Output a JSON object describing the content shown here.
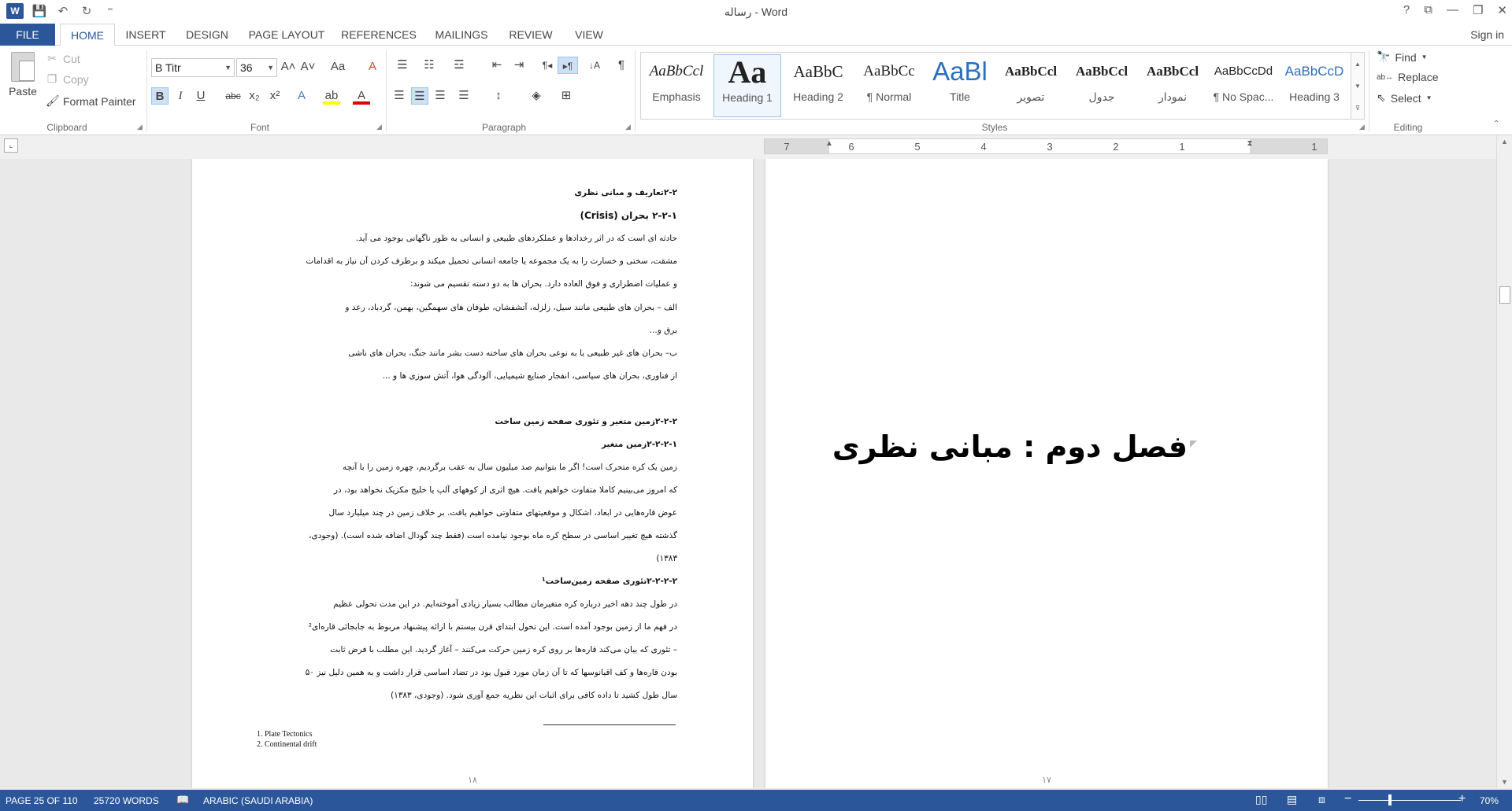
{
  "title": {
    "text": "رساله - Word",
    "help": "?",
    "ribbon_display": "⧉",
    "minimize": "—",
    "restore": "❐",
    "close": "✕"
  },
  "qat": {
    "logo": "W",
    "save": "💾",
    "undo": "↶",
    "redo": "↻",
    "customize": "⁼"
  },
  "tabs": [
    "FILE",
    "HOME",
    "INSERT",
    "DESIGN",
    "PAGE LAYOUT",
    "REFERENCES",
    "MAILINGS",
    "REVIEW",
    "VIEW"
  ],
  "active_tab": "HOME",
  "sign_in": "Sign in",
  "clipboard": {
    "paste": "Paste",
    "cut": "Cut",
    "copy": "Copy",
    "format_painter": "Format Painter",
    "label": "Clipboard"
  },
  "font": {
    "name": "B Titr",
    "size": "36",
    "label": "Font",
    "buttons": {
      "grow": "A˄",
      "shrink": "A˅",
      "case": "Aa",
      "clear": "A",
      "bold": "B",
      "italic": "I",
      "underline": "U",
      "strike": "abc",
      "sub": "x₂",
      "sup": "x²",
      "effects": "A",
      "highlight": "ab",
      "color": "A"
    },
    "highlight_color": "#ffff00",
    "font_color": "#e00000"
  },
  "paragraph": {
    "label": "Paragraph",
    "buttons": {
      "bullets": "☰",
      "numbering": "☷",
      "multilevel": "☲",
      "decrease_indent": "⇤",
      "increase_indent": "⇥",
      "ltr": "¶◂",
      "rtl": "▸¶",
      "sort": "↓A",
      "show_marks": "¶",
      "align_left": "☰",
      "center": "☰",
      "align_right": "☰",
      "justify": "☰",
      "line_spacing": "↕",
      "shading": "◈",
      "borders": "⊞"
    }
  },
  "styles": {
    "label": "Styles",
    "items": [
      {
        "preview": "AaBbCcl",
        "name": "Emphasis"
      },
      {
        "preview": "Aa",
        "name": "Heading 1"
      },
      {
        "preview": "AaBbC",
        "name": "Heading 2"
      },
      {
        "preview": "AaBbCc",
        "name": "¶ Normal"
      },
      {
        "preview": "AaBl",
        "name": "Title"
      },
      {
        "preview": "AaBbCcl",
        "name": "تصویر"
      },
      {
        "preview": "AaBbCcl",
        "name": "جدول"
      },
      {
        "preview": "AaBbCcl",
        "name": "نمودار"
      },
      {
        "preview": "AaBbCcDd",
        "name": "¶ No Spac..."
      },
      {
        "preview": "AaBbCcD",
        "name": "Heading 3"
      }
    ],
    "selected_index": 1,
    "scroll_up": "▲",
    "scroll_down": "▼",
    "more": "⊽"
  },
  "editing": {
    "label": "Editing",
    "find": "Find",
    "replace": "Replace",
    "select": "Select"
  },
  "ruler": {
    "numbers": [
      "7",
      "6",
      "5",
      "4",
      "3",
      "2",
      "1",
      "1"
    ]
  },
  "left_page": {
    "paragraphs": [
      {
        "text": "۲-۲تعاریف و مبانی نظری",
        "bold": true
      },
      {
        "text": "۲-۲-۱ بحران (Crisis)",
        "bold": true
      },
      {
        "text": "حادثه ای است که در اثر رخدادها و عملکردهای طبیعی و انسانی به طور ناگهانی بوجود می آید.",
        "bold": false
      },
      {
        "text": "مشقت، سختی و خسارت را به یک مجموعه یا جامعه انسانی تحمیل میکند و برطرف کردن آن نیاز به اقدامات",
        "bold": false
      },
      {
        "text": "و عملیات اضطراری و فوق العاده دارد.  بحران ها به دو دسته تقسیم می شوند:",
        "bold": false
      },
      {
        "text": "الف – بحران های طبیعی مانند سیل، زلزله، آتشفشان، طوفان های سهمگین، بهمن، گردباد، رعد و",
        "bold": false
      },
      {
        "text": "برق و...",
        "bold": false
      },
      {
        "text": "ب– بحران های غیر طبیعی یا به نوعی بحران های ساخته دست بشر مانند جنگ، بحران های ناشی",
        "bold": false
      },
      {
        "text": "از فناوری، بحران های سیاسی، انفجار صنایع شیمیایی، آلودگی هوا، آتش سوزی ها و ...",
        "bold": false
      },
      {
        "text": "",
        "bold": false
      },
      {
        "text": "۲-۲-۲زمین متغیر و تئوری صفحه زمین ساخت",
        "bold": true
      },
      {
        "text": "۲-۲-۲-۱زمین متغیر",
        "bold": true
      },
      {
        "text": "زمین یک کره متحرک است! اگر ما بتوانیم صد میلیون سال به عقب برگردیم، چهره زمین را با آنچه",
        "bold": false
      },
      {
        "text": "که امروز می‌بینیم کاملا متفاوت خواهیم یافت.  هیچ اثری از کوههای آلپ یا خلیج مکزیک نخواهد بود، در",
        "bold": false
      },
      {
        "text": "عوض قاره‌هایی در ابعاد، اشکال و موقعیتهای متفاوتی خواهیم یافت. بر خلاف زمین در چند میلیارد سال",
        "bold": false
      },
      {
        "text": "گذشته هیچ تغییر اساسی در سطح کره ماه بوجود نیامده است (فقط چند گودال اضافه شده است). (وجودی،",
        "bold": false
      },
      {
        "text": "۱۳۸۳)",
        "bold": false
      },
      {
        "text": "۲-۲-۲-۲تئوری صفحه زمین‌ساخت¹",
        "bold": true
      },
      {
        "text": "در طول چند دهه اخیر درباره کره متغیرمان مطالب بسیار زیادی آموخته‌ایم. در این مدت تحولی عظیم",
        "bold": false
      },
      {
        "text": "در فهم ما از زمین بوجود آمده است. این تحول ابتدای قرن بیستم با ارائه پیشنهاد مربوط به جابجائی قاره‌ای²",
        "bold": false
      },
      {
        "text": "– تئوری که بیان می‌کند قاره‌ها بر روی کره زمین حرکت می‌کنند – آغاز گردید. این مطلب با فرض ثابت",
        "bold": false
      },
      {
        "text": "بودن قاره‌ها و کف اقیانوسها که تا آن زمان مورد قبول بود در تضاد اساسی قرار داشت و به همین دلیل نیز ۵۰",
        "bold": false
      },
      {
        "text": "سال طول کشید تا داده کافی برای اثبات این نظریه جمع آوری شود. (وجودی، ۱۳۸۳)",
        "bold": false
      }
    ],
    "footnotes": [
      "1. Plate Tectonics",
      "2. Continental drift"
    ],
    "page_number": "۱۸"
  },
  "right_page": {
    "chapter_title": "فصل دوم : مبانی نظری",
    "page_number": "۱۷"
  },
  "status": {
    "page": "PAGE 25 OF 110",
    "words": "25720 WORDS",
    "language": "ARABIC (SAUDI ARABIA)",
    "zoom_minus": "−",
    "zoom_plus": "+",
    "zoom": "70%",
    "zoom_fraction": 0.7
  },
  "colors": {
    "accent": "#2b579a"
  }
}
